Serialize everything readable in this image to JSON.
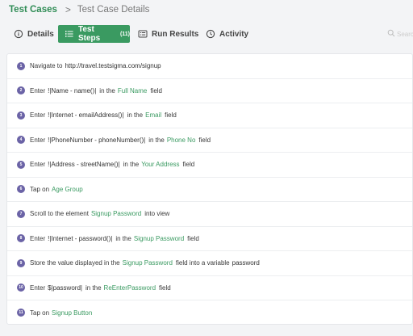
{
  "breadcrumb": {
    "root": "Test Cases",
    "separator": ">",
    "current": "Test Case Details"
  },
  "tabs": {
    "details": "Details",
    "steps": "Test Steps",
    "steps_count": "(11)",
    "results": "Run Results",
    "activity": "Activity"
  },
  "search": {
    "placeholder": "Search"
  },
  "colors": {
    "accent": "#3a9a61",
    "step_badge": "#6b63a6"
  },
  "steps": [
    {
      "num": "1",
      "parts": [
        {
          "t": "Navigate to"
        },
        {
          "t": "http://travel.testsigma.com/signup",
          "c": "dark"
        }
      ]
    },
    {
      "num": "2",
      "parts": [
        {
          "t": "Enter"
        },
        {
          "t": "!|Name - name()|",
          "c": "dark"
        },
        {
          "t": "in the"
        },
        {
          "t": "Full Name",
          "c": "green"
        },
        {
          "t": "field"
        }
      ]
    },
    {
      "num": "3",
      "parts": [
        {
          "t": "Enter"
        },
        {
          "t": "!|Internet - emailAddress()|",
          "c": "dark"
        },
        {
          "t": "in the"
        },
        {
          "t": "Email",
          "c": "green"
        },
        {
          "t": "field"
        }
      ]
    },
    {
      "num": "4",
      "parts": [
        {
          "t": "Enter"
        },
        {
          "t": "!|PhoneNumber - phoneNumber()|",
          "c": "dark"
        },
        {
          "t": "in the"
        },
        {
          "t": "Phone No",
          "c": "green"
        },
        {
          "t": "field"
        }
      ]
    },
    {
      "num": "5",
      "parts": [
        {
          "t": "Enter"
        },
        {
          "t": "!|Address - streetName()|",
          "c": "dark"
        },
        {
          "t": "in the"
        },
        {
          "t": "Your Address",
          "c": "green"
        },
        {
          "t": "field"
        }
      ]
    },
    {
      "num": "6",
      "parts": [
        {
          "t": "Tap on"
        },
        {
          "t": "Age Group",
          "c": "green"
        }
      ]
    },
    {
      "num": "7",
      "parts": [
        {
          "t": "Scroll to the element"
        },
        {
          "t": "Signup Password",
          "c": "green"
        },
        {
          "t": "into view"
        }
      ]
    },
    {
      "num": "8",
      "parts": [
        {
          "t": "Enter"
        },
        {
          "t": "!|Internet - password()|",
          "c": "dark"
        },
        {
          "t": "in the"
        },
        {
          "t": "Signup Password",
          "c": "green"
        },
        {
          "t": "field"
        }
      ]
    },
    {
      "num": "9",
      "parts": [
        {
          "t": "Store the value displayed in the"
        },
        {
          "t": "Signup Password",
          "c": "green"
        },
        {
          "t": "field into a variable"
        },
        {
          "t": "password",
          "c": "dark"
        }
      ]
    },
    {
      "num": "10",
      "parts": [
        {
          "t": "Enter"
        },
        {
          "t": "$|password|",
          "c": "dark"
        },
        {
          "t": "in the"
        },
        {
          "t": "ReEnterPassword",
          "c": "green"
        },
        {
          "t": "field"
        }
      ]
    },
    {
      "num": "11",
      "parts": [
        {
          "t": "Tap on"
        },
        {
          "t": "Signup Button",
          "c": "green"
        }
      ]
    }
  ]
}
